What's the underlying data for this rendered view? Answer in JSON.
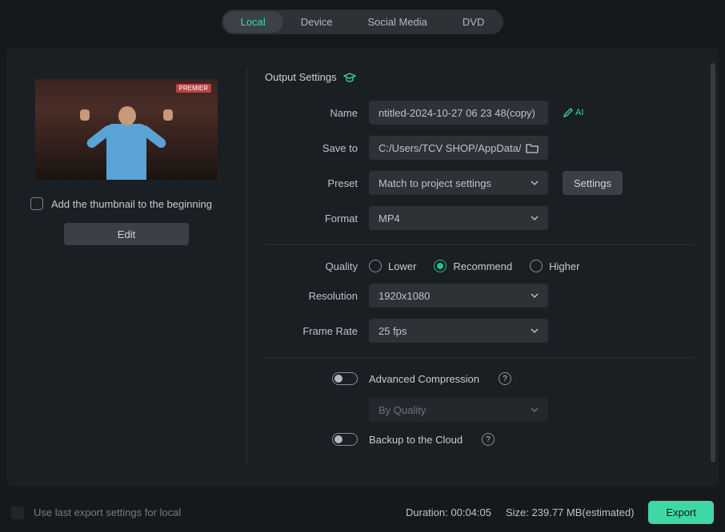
{
  "tabs": {
    "local": "Local",
    "device": "Device",
    "social": "Social Media",
    "dvd": "DVD"
  },
  "thumb_tag": "PREMIER",
  "thumb_check_label": "Add the thumbnail to the beginning",
  "edit_label": "Edit",
  "section_title": "Output Settings",
  "labels": {
    "name": "Name",
    "save_to": "Save to",
    "preset": "Preset",
    "format": "Format",
    "quality": "Quality",
    "resolution": "Resolution",
    "frame_rate": "Frame Rate"
  },
  "name_value": "ntitled-2024-10-27 06 23 48(copy)",
  "ai_label": "AI",
  "save_to_value": "C:/Users/TCV SHOP/AppData/",
  "preset_value": "Match to project settings",
  "settings_btn": "Settings",
  "format_value": "MP4",
  "quality_options": {
    "lower": "Lower",
    "recommend": "Recommend",
    "higher": "Higher"
  },
  "resolution_value": "1920x1080",
  "frame_rate_value": "25 fps",
  "adv_compression": "Advanced Compression",
  "compression_mode": "By Quality",
  "backup_cloud": "Backup to the Cloud",
  "use_last": "Use last export settings for local",
  "duration_label": "Duration:",
  "duration_value": "00:04:05",
  "size_label": "Size:",
  "size_value": "239.77 MB(estimated)",
  "export_label": "Export"
}
